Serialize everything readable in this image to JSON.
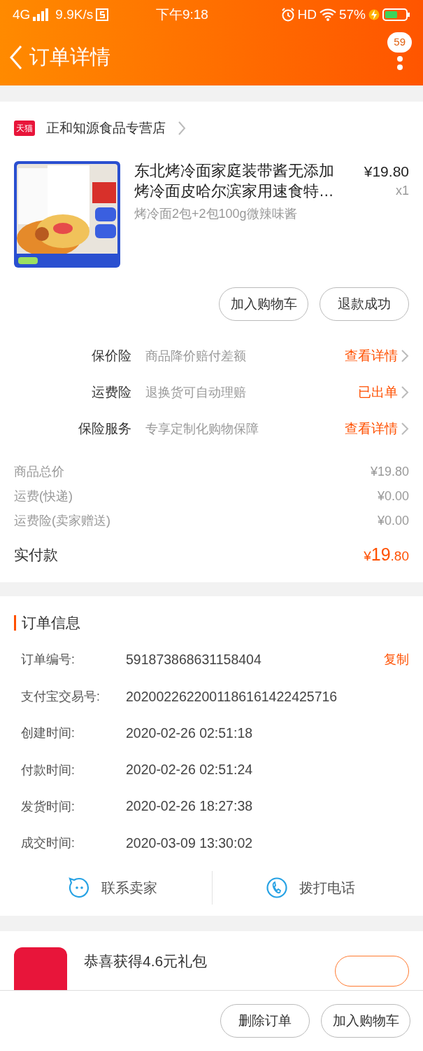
{
  "status_bar": {
    "network": "4G",
    "speed": "9.9K/s",
    "time": "下午9:18",
    "hd": "HD",
    "battery": "57%"
  },
  "nav": {
    "title": "订单详情",
    "badge": "59"
  },
  "shop": {
    "logo": "天猫",
    "name": "正和知源食品专营店"
  },
  "product": {
    "title": "东北烤冷面家庭装带酱无添加烤冷面皮哈尔滨家用速食特…",
    "sku": "烤冷面2包+2包100g微辣味酱",
    "price": "¥19.80",
    "quantity": "x1"
  },
  "item_buttons": [
    "加入购物车",
    "退款成功"
  ],
  "services": [
    {
      "label": "保价险",
      "description": "商品降价赔付差额",
      "action": "查看详情"
    },
    {
      "label": "运费险",
      "description": "退换货可自动理赔",
      "action": "已出单"
    },
    {
      "label": "保险服务",
      "description": "专享定制化购物保障",
      "action": "查看详情"
    }
  ],
  "costs": [
    {
      "label": "商品总价",
      "value": "¥19.80"
    },
    {
      "label": "运费(快递)",
      "value": "¥0.00"
    },
    {
      "label": "运费险(卖家赠送)",
      "value": "¥0.00"
    }
  ],
  "total": {
    "label": "实付款",
    "currency": "¥",
    "integer": "19",
    "decimal": ".80"
  },
  "order_info": {
    "title": "订单信息",
    "rows": [
      {
        "label": "订单编号:",
        "value": "591873868631158404",
        "action": "复制"
      },
      {
        "label": "支付宝交易号:",
        "value": "2020022622001186161422425716"
      },
      {
        "label": "创建时间:",
        "value": "2020-02-26 02:51:18"
      },
      {
        "label": "付款时间:",
        "value": "2020-02-26 02:51:24"
      },
      {
        "label": "发货时间:",
        "value": "2020-02-26 18:27:38"
      },
      {
        "label": "成交时间:",
        "value": "2020-03-09 13:30:02"
      }
    ]
  },
  "contact": [
    {
      "kind": "chat",
      "label": "联系卖家"
    },
    {
      "kind": "phone",
      "label": "拨打电话"
    }
  ],
  "promo": {
    "text": "恭喜获得4.6元礼包"
  },
  "bottom_actions": [
    "删除订单",
    "加入购物车"
  ]
}
